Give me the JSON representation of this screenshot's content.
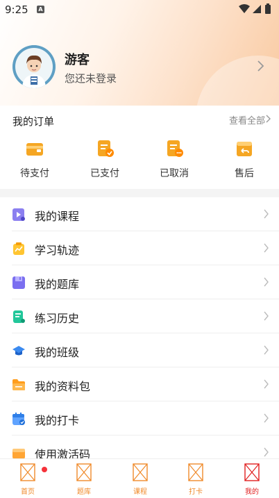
{
  "status_bar": {
    "time": "9:25",
    "sim_badge": "A"
  },
  "profile": {
    "name": "游客",
    "subtitle": "您还未登录"
  },
  "orders": {
    "title": "我的订单",
    "view_all": "查看全部",
    "items": [
      {
        "label": "待支付",
        "icon": "wallet-icon"
      },
      {
        "label": "已支付",
        "icon": "paid-document-icon"
      },
      {
        "label": "已取消",
        "icon": "cancelled-document-icon"
      },
      {
        "label": "售后",
        "icon": "return-box-icon"
      }
    ]
  },
  "menu": {
    "items": [
      {
        "label": "我的课程",
        "icon": "course-icon"
      },
      {
        "label": "学习轨迹",
        "icon": "study-track-icon"
      },
      {
        "label": "我的题库",
        "icon": "question-bank-icon"
      },
      {
        "label": "练习历史",
        "icon": "practice-history-icon"
      },
      {
        "label": "我的班级",
        "icon": "class-graduation-cap-icon"
      },
      {
        "label": "我的资料包",
        "icon": "folder-icon"
      },
      {
        "label": "我的打卡",
        "icon": "calendar-check-icon"
      },
      {
        "label": "使用激活码",
        "icon": "activation-code-icon"
      }
    ]
  },
  "tabbar": {
    "items": [
      {
        "label": "首页"
      },
      {
        "label": "题库"
      },
      {
        "label": "课程"
      },
      {
        "label": "打卡"
      },
      {
        "label": "我的"
      }
    ]
  },
  "colors": {
    "accent": "#f08a2a",
    "active_tab": "#e02020",
    "badge": "#f5323a"
  }
}
